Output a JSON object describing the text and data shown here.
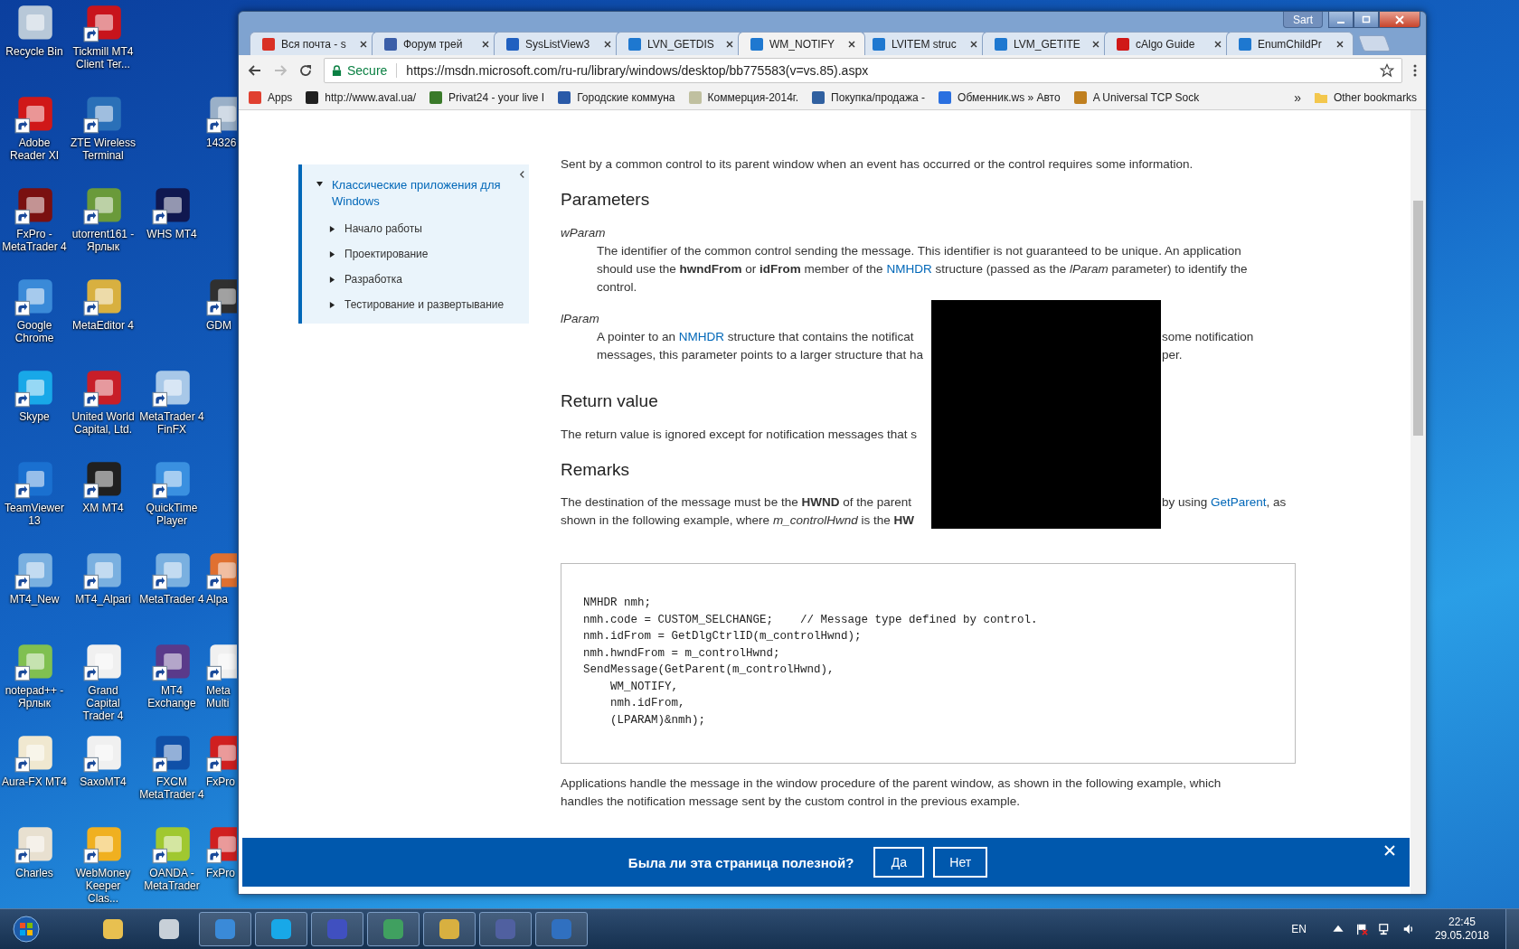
{
  "desktop": {
    "rows": [
      [
        {
          "label": "Recycle Bin",
          "color": "#b8c8d8",
          "shortcut": false
        },
        {
          "label": "Tickmill MT4 Client Ter...",
          "color": "#c8141c",
          "shortcut": true
        },
        null,
        null
      ],
      [
        {
          "label": "Adobe Reader XI",
          "color": "#d01818",
          "shortcut": true
        },
        {
          "label": "ZTE Wireless Terminal",
          "color": "#2a70b8",
          "shortcut": true
        },
        null,
        {
          "label": "14326",
          "color": "#9ab0c8",
          "shortcut": true
        }
      ],
      [
        {
          "label": "FxPro - MetaTrader 4",
          "color": "#7a1010",
          "shortcut": true
        },
        {
          "label": "utorrent161 - Ярлык",
          "color": "#6a9a3a",
          "shortcut": true
        },
        {
          "label": "WHS MT4",
          "color": "#101850",
          "shortcut": true
        },
        null
      ],
      [
        {
          "label": "Google Chrome",
          "color": "#3a8ad8",
          "shortcut": true
        },
        {
          "label": "MetaEditor 4",
          "color": "#d8b040",
          "shortcut": true
        },
        null,
        {
          "label": "GDM",
          "color": "#303030",
          "shortcut": true
        }
      ],
      [
        {
          "label": "Skype",
          "color": "#18a8e8",
          "shortcut": true
        },
        {
          "label": "United World Capital, Ltd.",
          "color": "#c81e28",
          "shortcut": true
        },
        {
          "label": "MetaTrader 4 FinFX",
          "color": "#a8c8e8",
          "shortcut": true
        },
        null
      ],
      [
        {
          "label": "TeamViewer 13",
          "color": "#1a70d0",
          "shortcut": true
        },
        {
          "label": "XM MT4",
          "color": "#202020",
          "shortcut": true
        },
        {
          "label": "QuickTime Player",
          "color": "#3a90e0",
          "shortcut": true
        },
        null
      ],
      [
        {
          "label": "MT4_New",
          "color": "#7ab0e0",
          "shortcut": true
        },
        {
          "label": "MT4_Alpari",
          "color": "#7ab0e0",
          "shortcut": true
        },
        {
          "label": "MetaTrader 4",
          "color": "#7ab0e0",
          "shortcut": true
        },
        {
          "label": "Alpa",
          "color": "#e07030",
          "shortcut": true
        }
      ],
      [
        {
          "label": "notepad++ - Ярлык",
          "color": "#80c050",
          "shortcut": true
        },
        {
          "label": "Grand Capital Trader 4",
          "color": "#f0f0f0",
          "shortcut": true
        },
        {
          "label": "MT4 Exchange",
          "color": "#5a3a8a",
          "shortcut": true
        },
        {
          "label": "Meta Multi",
          "color": "#f0f0f0",
          "shortcut": true
        }
      ],
      [
        {
          "label": "Aura-FX MT4",
          "color": "#f0e8d0",
          "shortcut": true
        },
        {
          "label": "SaxoMT4",
          "color": "#f0f0f0",
          "shortcut": true
        },
        {
          "label": "FXCM MetaTrader 4",
          "color": "#1050a8",
          "shortcut": true
        },
        {
          "label": "FxPro",
          "color": "#d02020",
          "shortcut": true
        }
      ],
      [
        {
          "label": "Charles",
          "color": "#e8e0d0",
          "shortcut": true
        },
        {
          "label": "WebMoney Keeper Clas...",
          "color": "#f0b020",
          "shortcut": true
        },
        {
          "label": "OANDA - MetaTrader",
          "color": "#a0c830",
          "shortcut": true
        },
        {
          "label": "FxPro",
          "color": "#d02020",
          "shortcut": true
        }
      ]
    ]
  },
  "browser": {
    "profile": "Sart",
    "tabs": [
      {
        "title": "Вся почта - s",
        "color": "#d93025",
        "selected": false
      },
      {
        "title": "Форум трей",
        "color": "#3a5ea8",
        "selected": false
      },
      {
        "title": "SysListView3",
        "color": "#2060c0",
        "selected": false
      },
      {
        "title": "LVN_GETDIS",
        "color": "#1e78d0",
        "selected": false
      },
      {
        "title": "WM_NOTIFY",
        "color": "#1e78d0",
        "selected": true
      },
      {
        "title": "LVITEM struc",
        "color": "#1e78d0",
        "selected": false
      },
      {
        "title": "LVM_GETITE",
        "color": "#1e78d0",
        "selected": false
      },
      {
        "title": "cAlgo Guide",
        "color": "#d01818",
        "selected": false
      },
      {
        "title": "EnumChildPr",
        "color": "#1e78d0",
        "selected": false
      }
    ],
    "security": "Secure",
    "url": "https://msdn.microsoft.com/ru-ru/library/windows/desktop/bb775583(v=vs.85).aspx",
    "bookmarks": [
      {
        "label": "Apps",
        "color": "#e04030"
      },
      {
        "label": "http://www.aval.ua/",
        "color": "#202020"
      },
      {
        "label": "Privat24 - your live I",
        "color": "#3a7a2a"
      },
      {
        "label": "Городские коммуна",
        "color": "#2a5aa8"
      },
      {
        "label": "Коммерция-2014г.",
        "color": "#c0c0a0"
      },
      {
        "label": "Покупка/продажа -",
        "color": "#3060a0"
      },
      {
        "label": "Обменник.ws » Авто",
        "color": "#2a70e0"
      },
      {
        "label": "A Universal TCP Sock",
        "color": "#c08020"
      }
    ],
    "more_bookmarks": "»",
    "other_bookmarks": "Other bookmarks"
  },
  "page": {
    "nav": {
      "label": "Классические приложения для Windows",
      "expanded": true,
      "children": [
        {
          "label": "Начало работы",
          "expanded": false
        },
        {
          "label": "Проектирование",
          "expanded": false
        },
        {
          "label": "Разработка",
          "expanded": false
        },
        {
          "label": "Тестирование и развертывание",
          "expanded": false
        }
      ]
    },
    "intro": "Sent by a common control to its parent window when an event has occurred or the control requires some information.",
    "parameters_heading": "Parameters",
    "wparam": {
      "term": "wParam",
      "text": [
        {
          "kind": "text",
          "text": "The identifier of the common control sending the message. This identifier is not guaranteed to be unique. An application should use the **hwndFrom** or **idFrom** member of the "
        },
        {
          "kind": "link",
          "text": "NMHDR"
        },
        {
          "kind": "text",
          "text": " structure (passed as the *lParam* parameter) to identify the control."
        }
      ]
    },
    "lparam": {
      "term": "lParam",
      "lines": [
        {
          "left": [
            {
              "kind": "text",
              "text": "A pointer to an "
            },
            {
              "kind": "link",
              "text": "NMHDR"
            },
            {
              "kind": "text",
              "text": " structure that contains the notificat"
            }
          ],
          "right": [
            {
              "kind": "text",
              "text": "some notification"
            }
          ]
        },
        {
          "left": [
            {
              "kind": "text",
              "text": "messages, this parameter points to a larger structure that ha"
            }
          ],
          "right": [
            {
              "kind": "text",
              "text": "per."
            }
          ]
        }
      ]
    },
    "return_heading": "Return value",
    "return_text": "The return value is ignored except for notification messages that s",
    "remarks_heading": "Remarks",
    "remarks_lines": [
      {
        "left": [
          {
            "kind": "text",
            "text": "The destination of the message must be the **HWND** of the parent"
          }
        ],
        "right": [
          {
            "kind": "text",
            "text": "by using "
          },
          {
            "kind": "link",
            "text": "GetParent"
          },
          {
            "kind": "text",
            "text": ", as"
          }
        ]
      },
      {
        "left": [
          {
            "kind": "text",
            "text": "shown in the following example, where *m_controlHwnd* is the **HW**"
          }
        ]
      }
    ],
    "code": [
      "NMHDR nmh;",
      "nmh.code = CUSTOM_SELCHANGE;    // Message type defined by control.",
      "nmh.idFrom = GetDlgCtrlID(m_controlHwnd);",
      "nmh.hwndFrom = m_controlHwnd;",
      "SendMessage(GetParent(m_controlHwnd),",
      "    WM_NOTIFY,",
      "    nmh.idFrom,",
      "    (LPARAM)&nmh);"
    ],
    "after_code": "Applications handle the message in the window procedure of the parent window, as shown in the following example, which handles the notification message sent by the custom control in the previous example.",
    "feedback": {
      "question": "Была ли эта страница полезной?",
      "buttons": [
        "Да",
        "Нет"
      ]
    }
  },
  "taskbar": {
    "apps": [
      {
        "color": "#e8c050",
        "open": false
      },
      {
        "color": "#c8d0d8",
        "open": false
      },
      {
        "color": "#3a8ad8",
        "open": true
      },
      {
        "color": "#18a8e8",
        "open": true
      },
      {
        "color": "#4050c0",
        "open": true
      },
      {
        "color": "#40a060",
        "open": true
      },
      {
        "color": "#d8b040",
        "open": true
      },
      {
        "color": "#5060a0",
        "open": true
      },
      {
        "color": "#3070c0",
        "open": true
      }
    ],
    "language": "EN",
    "time": "22:45",
    "date": "29.05.2018"
  }
}
